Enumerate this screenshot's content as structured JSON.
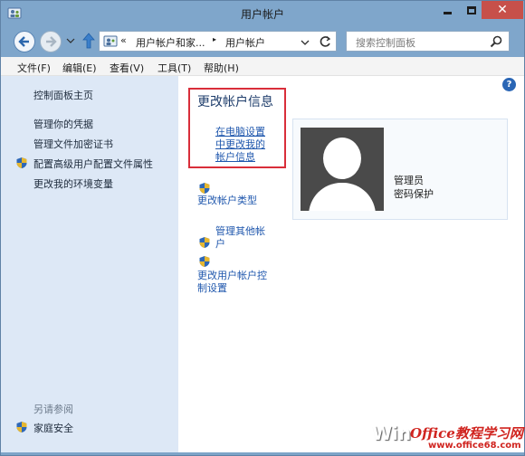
{
  "window": {
    "title": "用户帐户",
    "close_glyph": "✕"
  },
  "navigation": {
    "breadcrumb_chevron": "«",
    "breadcrumb": [
      "用户帐户和家...",
      "用户帐户"
    ],
    "separator": "▸",
    "search_placeholder": "搜索控制面板"
  },
  "menu": [
    "文件(F)",
    "编辑(E)",
    "查看(V)",
    "工具(T)",
    "帮助(H)"
  ],
  "left_panel": {
    "links": [
      {
        "label": "控制面板主页",
        "shield": false
      },
      {
        "label": "管理你的凭据",
        "shield": false
      },
      {
        "label": "管理文件加密证书",
        "shield": false
      },
      {
        "label": "配置高级用户配置文件属性",
        "shield": true
      },
      {
        "label": "更改我的环境变量",
        "shield": false
      }
    ],
    "see_also_title": "另请参阅",
    "see_also_items": [
      {
        "label": "家庭安全",
        "shield": true
      }
    ]
  },
  "main": {
    "heading": "更改帐户信息",
    "pc_settings_link": "在电脑设置中更改我的帐户信息",
    "pc_settings_lines": [
      "在电脑设置",
      "中更改我的",
      "帐户信息"
    ],
    "user": {
      "name": "管理员",
      "subtitle": "密码保护"
    },
    "links": [
      {
        "lines": [
          "更改帐户类型"
        ],
        "shield": true
      },
      {
        "lines": [
          "管理其他帐",
          "户"
        ],
        "shield": true
      },
      {
        "lines": [
          "更改用户帐户控",
          "制设置"
        ],
        "shield": true
      }
    ]
  },
  "help_label": "?",
  "watermark": {
    "prefix": "Win",
    "brand": "Office教程学习网",
    "url": "www.office68.com"
  },
  "colors": {
    "title_bar": "#7fa6cb",
    "left_panel": "#dde8f6",
    "link": "#1f57ad",
    "heading": "#1e3d6b",
    "highlight_border": "#d92e3a",
    "close_button": "#c7504a",
    "watermark_red": "#d0241f"
  }
}
